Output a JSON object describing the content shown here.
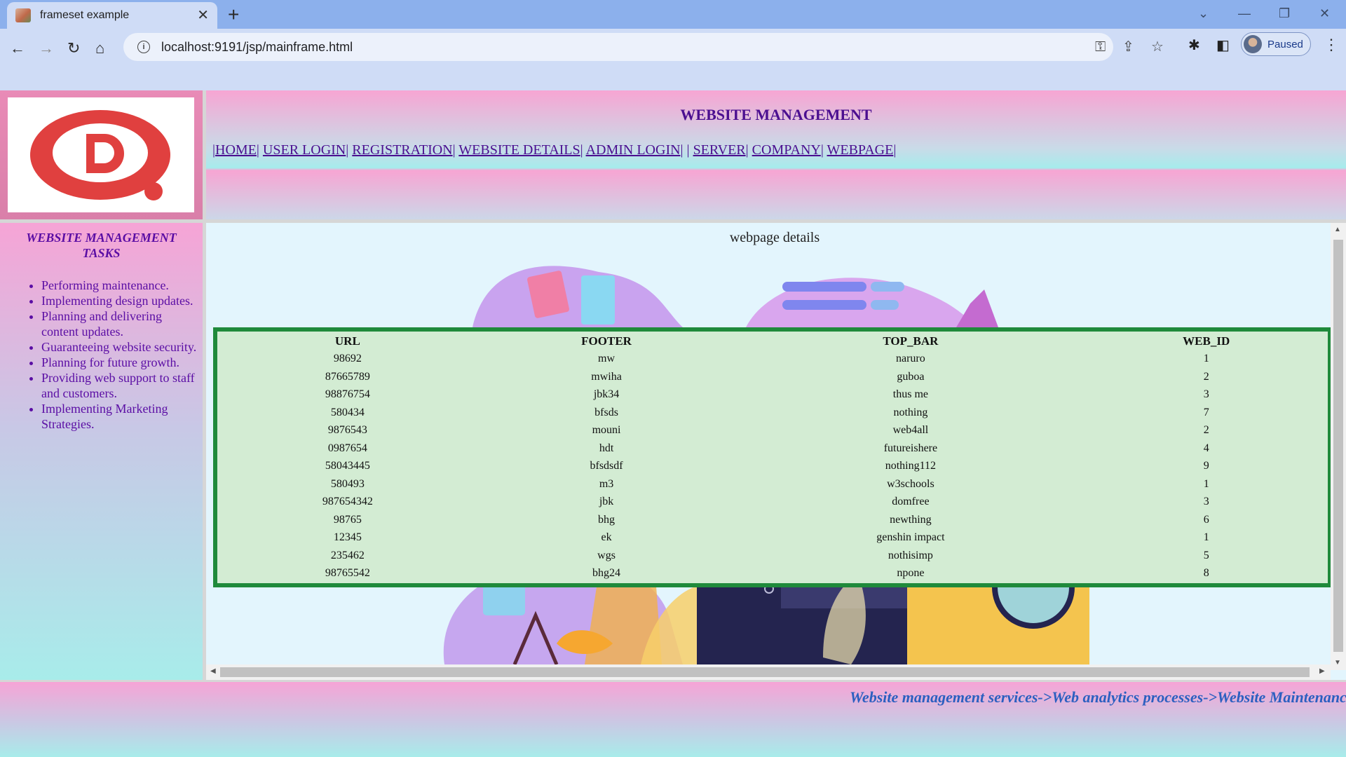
{
  "browser": {
    "tab_title": "frameset example",
    "tab_close": "✕",
    "new_tab": "+",
    "url": "localhost:9191/jsp/mainframe.html",
    "profile_label": "Paused",
    "icons": [
      "back-icon",
      "forward-icon",
      "reload-icon",
      "home-icon",
      "site-info-icon",
      "key-icon",
      "share-icon",
      "star-icon",
      "extensions-icon",
      "side-panel-icon",
      "menu-icon"
    ]
  },
  "header": {
    "title": "WEBSITE MANAGEMENT",
    "nav": [
      "HOME",
      "USER LOGIN",
      "REGISTRATION",
      "WEBSITE DETAILS",
      "ADMIN LOGIN",
      "SERVER",
      "COMPANY",
      "WEBPAGE"
    ],
    "logo_letter": "D"
  },
  "sidebar": {
    "heading": "WEBSITE MANAGEMENT TASKS",
    "items": [
      "Performing maintenance.",
      "Implementing design updates.",
      "Planning and delivering content updates.",
      "Guaranteeing website security.",
      "Planning for future growth.",
      "Providing web support to staff and customers.",
      "Implementing Marketing Strategies."
    ]
  },
  "main": {
    "title": "webpage details",
    "columns": [
      "URL",
      "FOOTER",
      "TOP_BAR",
      "WEB_ID"
    ],
    "rows": [
      [
        "98692",
        "mw",
        "naruro",
        "1"
      ],
      [
        "87665789",
        "mwiha",
        "guboa",
        "2"
      ],
      [
        "98876754",
        "jbk34",
        "thus me",
        "3"
      ],
      [
        "580434",
        "bfsds",
        "nothing",
        "7"
      ],
      [
        "9876543",
        "mouni",
        "web4all",
        "2"
      ],
      [
        "0987654",
        "hdt",
        "futureishere",
        "4"
      ],
      [
        "58043445",
        "bfsdsdf",
        "nothing112",
        "9"
      ],
      [
        "580493",
        "m3",
        "w3schools",
        "1"
      ],
      [
        "987654342",
        "jbk",
        "domfree",
        "3"
      ],
      [
        "98765",
        "bhg",
        "newthing",
        "6"
      ],
      [
        "12345",
        "ek",
        "genshin impact",
        "1"
      ],
      [
        "235462",
        "wgs",
        "nothisimp",
        "5"
      ],
      [
        "98765542",
        "bhg24",
        "npone",
        "8"
      ]
    ]
  },
  "footer": {
    "marquee": "Website management services->Web analytics processes->Website Maintenanc"
  },
  "colors": {
    "accent_purple": "#4b0f90",
    "table_border": "#1f8a3b",
    "table_bg": "#d3ecd3",
    "marquee_blue": "#2b5fc0",
    "logo_red": "#e0403f"
  }
}
